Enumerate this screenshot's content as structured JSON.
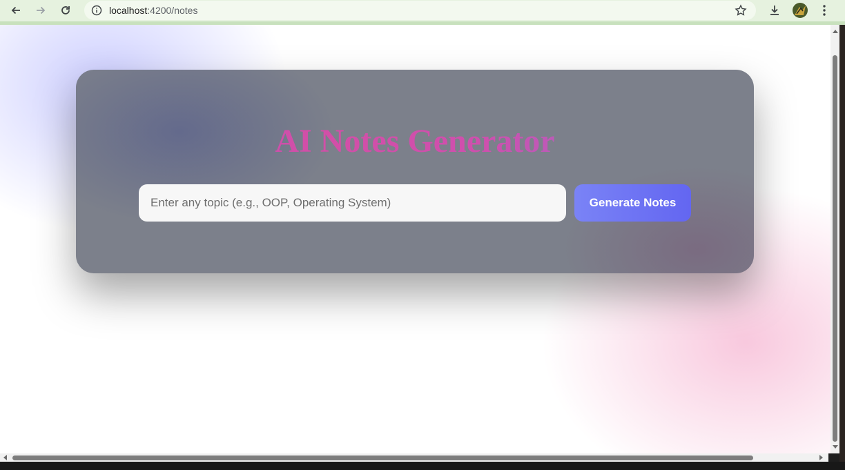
{
  "browser": {
    "url_host": "localhost",
    "url_path": ":4200/notes"
  },
  "page": {
    "title": "AI Notes Generator",
    "input_placeholder": "Enter any topic (e.g., OOP, Operating System)",
    "input_value": "",
    "button_label": "Generate Notes"
  },
  "colors": {
    "accent": "#6366f1",
    "title_gradient_start": "#b54fc0",
    "title_gradient_end": "#8d78d6"
  }
}
